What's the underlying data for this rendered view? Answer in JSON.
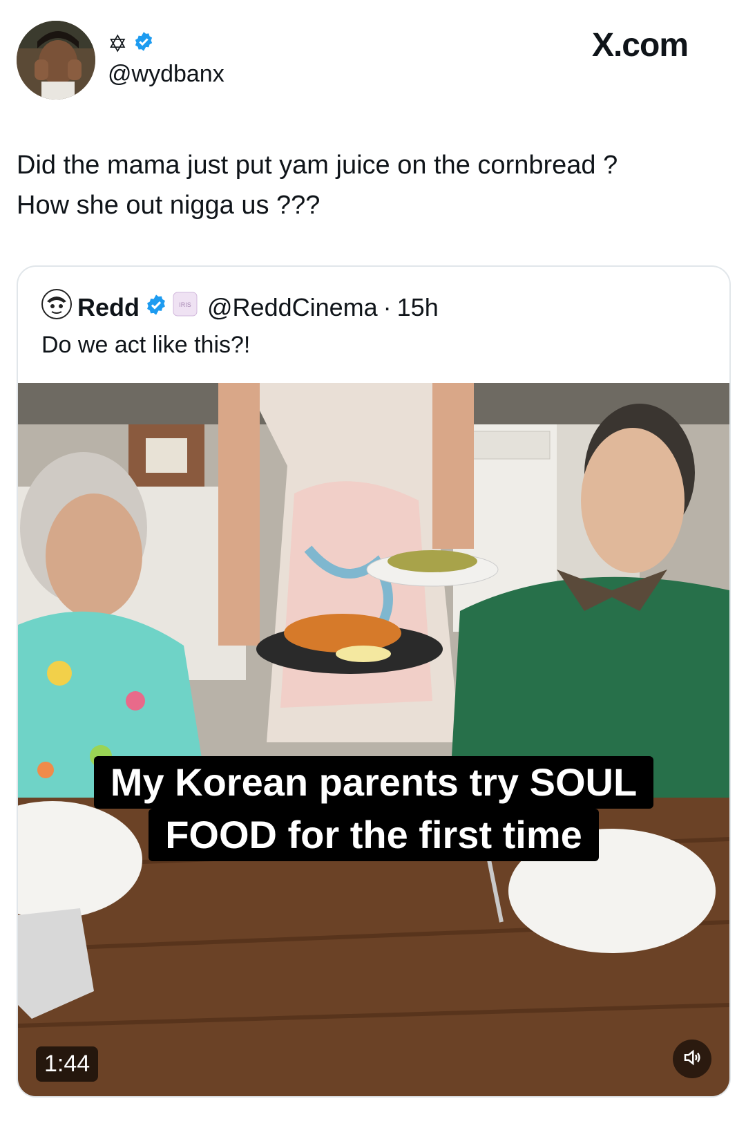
{
  "header": {
    "display_name_glyph": "✡",
    "handle": "@wydbanx",
    "brand": "X.com"
  },
  "tweet": {
    "line1": "Did the mama just put yam juice on the cornbread ?",
    "line2": "How she out nigga us ???"
  },
  "quote": {
    "name": "Redd",
    "badge": "IRIS",
    "handle": "@ReddCinema",
    "separator": "·",
    "time": "15h",
    "text": "Do we act like this?!"
  },
  "video": {
    "caption_line1": "My Korean parents try SOUL",
    "caption_line2": "FOOD for the first time",
    "duration": "1:44",
    "mute_icon": "speaker-icon"
  },
  "colors": {
    "verified": "#1d9bf0",
    "text": "#0f1419",
    "border": "#e1e6ea"
  }
}
